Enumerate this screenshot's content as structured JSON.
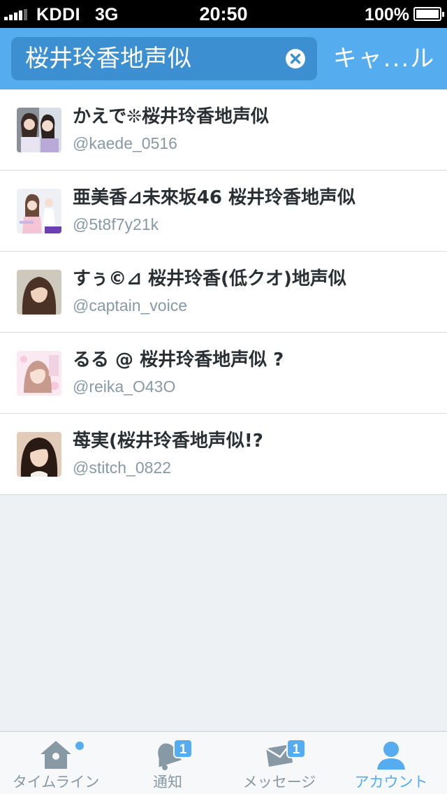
{
  "status_bar": {
    "carrier": "KDDI",
    "network": "3G",
    "time": "20:50",
    "battery": "100%"
  },
  "search": {
    "query": "桜井玲香地声似",
    "cancel_label": "キャ...ル"
  },
  "results": [
    {
      "name": "かえで❊桜井玲香地声似",
      "handle": "@kaede_0516"
    },
    {
      "name": "亜美香⊿未來坂46 桜井玲香地声似",
      "handle": "@5t8f7y21k"
    },
    {
      "name": "すぅ©⊿ 桜井玲香(低クオ)地声似",
      "handle": "@captain_voice"
    },
    {
      "name": "るる @ 桜井玲香地声似 ?",
      "handle": "@reika_O43O"
    },
    {
      "name": "苺実(桜井玲香地声似!?",
      "handle": "@stitch_0822"
    }
  ],
  "tabs": [
    {
      "label": "タイムライン",
      "icon": "home-icon",
      "badge": "",
      "dot": true
    },
    {
      "label": "通知",
      "icon": "bell-icon",
      "badge": "1"
    },
    {
      "label": "メッセージ",
      "icon": "envelope-icon",
      "badge": "1"
    },
    {
      "label": "アカウント",
      "icon": "person-icon",
      "badge": "",
      "active": true
    }
  ],
  "colors": {
    "accent": "#55acee",
    "search_field": "#3c8fd0",
    "tab_inactive": "#8899a6"
  }
}
